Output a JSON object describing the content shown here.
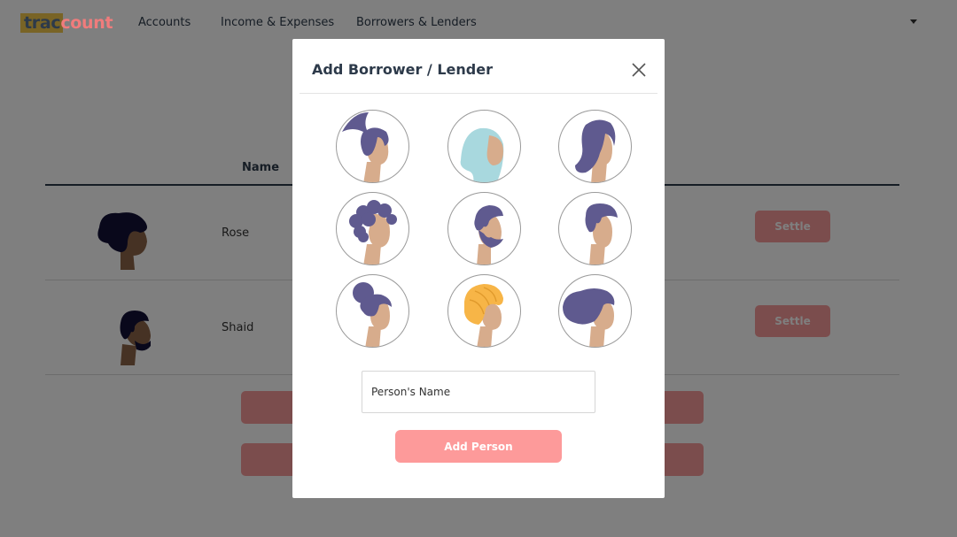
{
  "app": {
    "logo_part1": "trac",
    "logo_part2": "count"
  },
  "nav": {
    "items": [
      "Accounts",
      "Income & Expenses",
      "Borrowers & Lenders"
    ]
  },
  "table": {
    "header_name": "Name",
    "rows": [
      {
        "name": "Rose",
        "action": "Settle"
      },
      {
        "name": "Shaid",
        "action": "Settle"
      }
    ]
  },
  "modal": {
    "title": "Add Borrower / Lender",
    "avatars": [
      "ponytail-woman",
      "hijab-woman",
      "long-hair-woman",
      "curly-hair-person",
      "bearded-man",
      "short-hair-man",
      "bun-hair-woman",
      "turban-person",
      "wavy-hair-woman"
    ],
    "name_placeholder": "Person's Name",
    "submit_label": "Add Person"
  },
  "colors": {
    "accent": "#f07c7c",
    "button": "#fd9a9a",
    "hair": "#5f5a8f",
    "skin": "#d7ac8c",
    "logo_highlight": "#f2c94c"
  }
}
